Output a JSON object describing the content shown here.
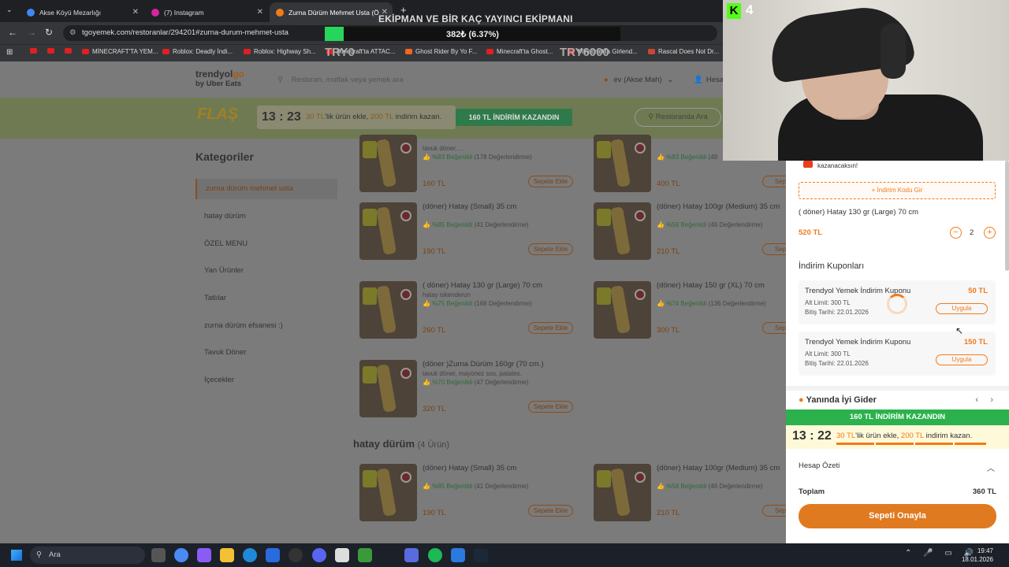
{
  "browser": {
    "tabs": [
      {
        "title": "Akse Köyü Mezarlığı",
        "icon": "google-icon",
        "color": "#4285f4"
      },
      {
        "title": "(7) Instagram",
        "icon": "instagram-icon",
        "color": "#d6249f"
      },
      {
        "title": "Zurna Dürüm Mehmet Usta (Ö",
        "icon": "trendyol-icon",
        "color": "#f27a1a",
        "active": true
      }
    ],
    "url": "tgoyemek.com/restoranlar/294201#zurna-durum-mehmet-usta",
    "bookmarks": [
      "MİNECRAFT'TA YEM...",
      "Roblox: Deadly İndi...",
      "Roblox: Highway Sh...",
      "Minecraft'ta ATTAC...",
      "Ghost Rider By Yo F...",
      "Minecraft'ta Ghost...",
      "Minecraft'ta Girlend...",
      "Rascal Does Not Dr..."
    ]
  },
  "overlay": {
    "title": "EKİPMAN VE BİR KAÇ YAYINCI EKİPMANI",
    "progress_text": "382₺ (6.37%)",
    "progress_pct": 6.37,
    "try_left": "TRY0",
    "try_right": "TRY6000"
  },
  "site": {
    "logo_main": "trendyol",
    "logo_go": "go",
    "logo_sub": "by Uber Eats",
    "search_placeholder": "Restoran, mutfak veya yemek ara",
    "location": "ev (Akse Mah)",
    "user": "Hesa"
  },
  "promo": {
    "flas": "FLAŞ",
    "timer": "13 : 23",
    "msg_a": "30 TL",
    "msg_b": "'lik ürün ekle, ",
    "msg_c": "200 TL",
    "msg_d": " indirim kazan.",
    "button": "160 TL İNDİRİM KAZANDIN",
    "restaurant_search": "Restoranda Ara"
  },
  "categories": {
    "title": "Kategoriler",
    "items": [
      "zurna dürüm mehmet usta",
      "hatay dürüm",
      "ÖZEL MENU",
      "Yan Ürünler",
      "Tatlılar",
      "zurna dürüm efsanesi :)",
      "Tavuk Döner",
      "İçecekler"
    ]
  },
  "products": [
    {
      "name": "",
      "desc": "tavuk döner, ...",
      "rating": "%83 Beğenildi",
      "reviews": "(178 Değerlendirme)",
      "price": "160 TL",
      "add": "Sepete Ekle"
    },
    {
      "name": "",
      "desc": "",
      "rating": "%83 Beğenildi",
      "reviews": "(49",
      "price": "400 TL",
      "add": "Sepete"
    },
    {
      "name": "(döner) Hatay (Small) 35 cm",
      "desc": "",
      "rating": "%85 Beğenildi",
      "reviews": "(41 Değerlendirme)",
      "price": "190 TL",
      "add": "Sepete Ekle"
    },
    {
      "name": "(döner) Hatay 100gr (Medium) 35 cm",
      "desc": "",
      "rating": "%58 Beğenildi",
      "reviews": "(46 Değerlendirme)",
      "price": "210 TL",
      "add": "Sepete"
    },
    {
      "name": "( döner) Hatay 130 gr (Large) 70 cm",
      "desc": "hatay iskenderun",
      "rating": "%75 Beğenildi",
      "reviews": "(168 Değerlendirme)",
      "price": "260 TL",
      "add": "Sepete Ekle"
    },
    {
      "name": "(döner) Hatay 150 gr (XL) 70 cm",
      "desc": "",
      "rating": "%74 Beğenildi",
      "reviews": "(136 Değerlendirme)",
      "price": "300 TL",
      "add": "Sepete"
    },
    {
      "name": "(döner )Zurna Dürüm 160gr (70 cm.)",
      "desc": "tavuk döner, mayonez sos, patates.",
      "rating": "%70 Beğenildi",
      "reviews": "(47 Değerlendirme)",
      "price": "320 TL",
      "add": "Sepete Ekle"
    },
    {
      "name": "(döner) Hatay (Small) 35 cm",
      "desc": "",
      "rating": "%85 Beğenildi",
      "reviews": "(41 Değerlendirme)",
      "price": "190 TL",
      "add": "Sepete Ekle"
    },
    {
      "name": "(döner) Hatay 100gr (Medium) 35 cm",
      "desc": "",
      "rating": "%58 Beğenildi",
      "reviews": "(46 Değerlendirme)",
      "price": "210 TL",
      "add": "Sepete"
    }
  ],
  "section": {
    "title": "hatay dürüm",
    "count": "(4 Ürün)"
  },
  "cart": {
    "note": "kazanacaksın!",
    "coupon_code": "İndirim Kodu Gir",
    "item_name": "( döner) Hatay 130 gr (Large) 70 cm",
    "item_price": "520 TL",
    "quantity": "2",
    "coupons_title": "İndirim Kuponları",
    "coupons": [
      {
        "name": "Trendyol Yemek İndirim Kuponu",
        "amount": "50 TL",
        "limit": "Alt Limit: 300 TL",
        "expiry": "Bitiş Tarihi: 22.01.2026",
        "apply": "Uygula"
      },
      {
        "name": "Trendyol Yemek İndirim Kuponu",
        "amount": "150 TL",
        "limit": "Alt Limit: 300 TL",
        "expiry": "Bitiş Tarihi: 22.01.2026",
        "apply": "Uygula"
      }
    ],
    "good_title": "Yanında İyi Gider",
    "banner": "160 TL İNDİRİM KAZANDIN",
    "timer": "13 : 22",
    "msg_a": "30 TL",
    "msg_b": "'lik ürün ekle, ",
    "msg_c": "200 TL",
    "msg_d": " indirim kazan.",
    "summary_title": "Hesap Özeti",
    "total_label": "Toplam",
    "total_value": "360 TL",
    "confirm": "Sepeti Onayla"
  },
  "cam": {
    "badge": "K",
    "number": "4"
  },
  "taskbar": {
    "search": "Ara",
    "time": "19:47",
    "date": "18.01.2026"
  }
}
